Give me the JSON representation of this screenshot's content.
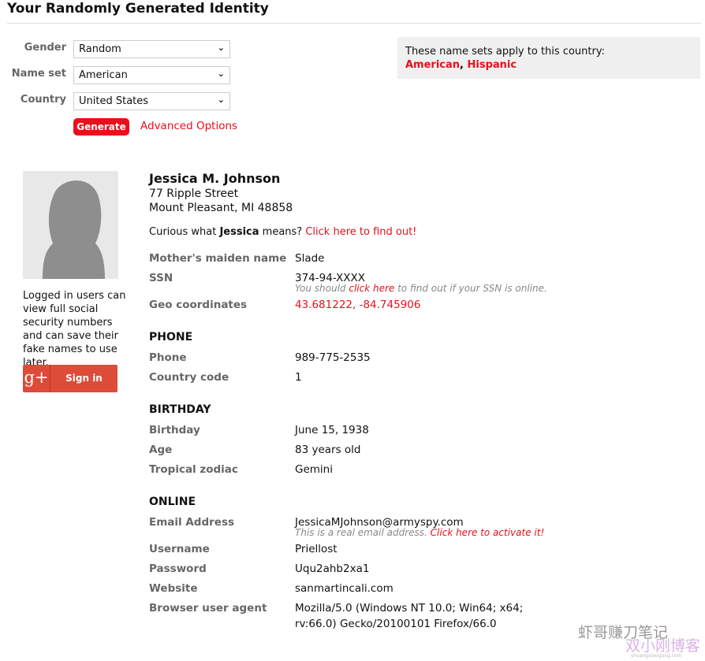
{
  "page": {
    "title": "Your Randomly Generated Identity"
  },
  "form": {
    "gender": {
      "label": "Gender",
      "value": "Random"
    },
    "name_set": {
      "label": "Name set",
      "value": "American"
    },
    "country": {
      "label": "Country",
      "value": "United States"
    },
    "generate": "Generate",
    "advanced": "Advanced Options"
  },
  "info_box": {
    "text": "These name sets apply to this country:",
    "sets": [
      "American",
      "Hispanic"
    ],
    "sep": ", "
  },
  "sidebar": {
    "note": "Logged in users can view full social security numbers and can save their fake names to use later.",
    "signin": "Sign in",
    "g_icon": "g+"
  },
  "identity": {
    "name": "Jessica M. Johnson",
    "street": "77 Ripple Street",
    "city": "Mount Pleasant, MI 48858",
    "curious_pre": "Curious what ",
    "first": "Jessica",
    "curious_post": " means? ",
    "curious_link": "Click here to find out!",
    "maiden": {
      "label": "Mother's maiden name",
      "value": "Slade"
    },
    "ssn": {
      "label": "SSN",
      "value": "374-94-XXXX",
      "note_pre": "You should ",
      "note_link": "click here",
      "note_post": " to find out if your SSN is online."
    },
    "geo": {
      "label": "Geo coordinates",
      "value": "43.681222, -84.745906"
    }
  },
  "phone": {
    "heading": "PHONE",
    "phone": {
      "label": "Phone",
      "value": "989-775-2535"
    },
    "code": {
      "label": "Country code",
      "value": "1"
    }
  },
  "birthday": {
    "heading": "BIRTHDAY",
    "birthday": {
      "label": "Birthday",
      "value": "June 15, 1938"
    },
    "age": {
      "label": "Age",
      "value": "83 years old"
    },
    "zodiac": {
      "label": "Tropical zodiac",
      "value": "Gemini"
    }
  },
  "online": {
    "heading": "ONLINE",
    "email": {
      "label": "Email Address",
      "value": "JessicaMJohnson@armyspy.com",
      "note_pre": "This is a real email address. ",
      "note_link": "Click here to activate it!"
    },
    "username": {
      "label": "Username",
      "value": "Priellost"
    },
    "password": {
      "label": "Password",
      "value": "Uqu2ahb2xa1"
    },
    "website": {
      "label": "Website",
      "value": "sanmartincali.com"
    },
    "ua": {
      "label": "Browser user agent",
      "value": "Mozilla/5.0 (Windows NT 10.0; Win64; x64; rv:66.0) Gecko/20100101 Firefox/66.0"
    }
  },
  "watermark": {
    "line1": "虾哥赚刀笔记",
    "line2": "双小刚博客",
    "url": "shuangxiaogang.com"
  },
  "colors": {
    "accent": "#e8101a",
    "gplus": "#dd4b39"
  }
}
